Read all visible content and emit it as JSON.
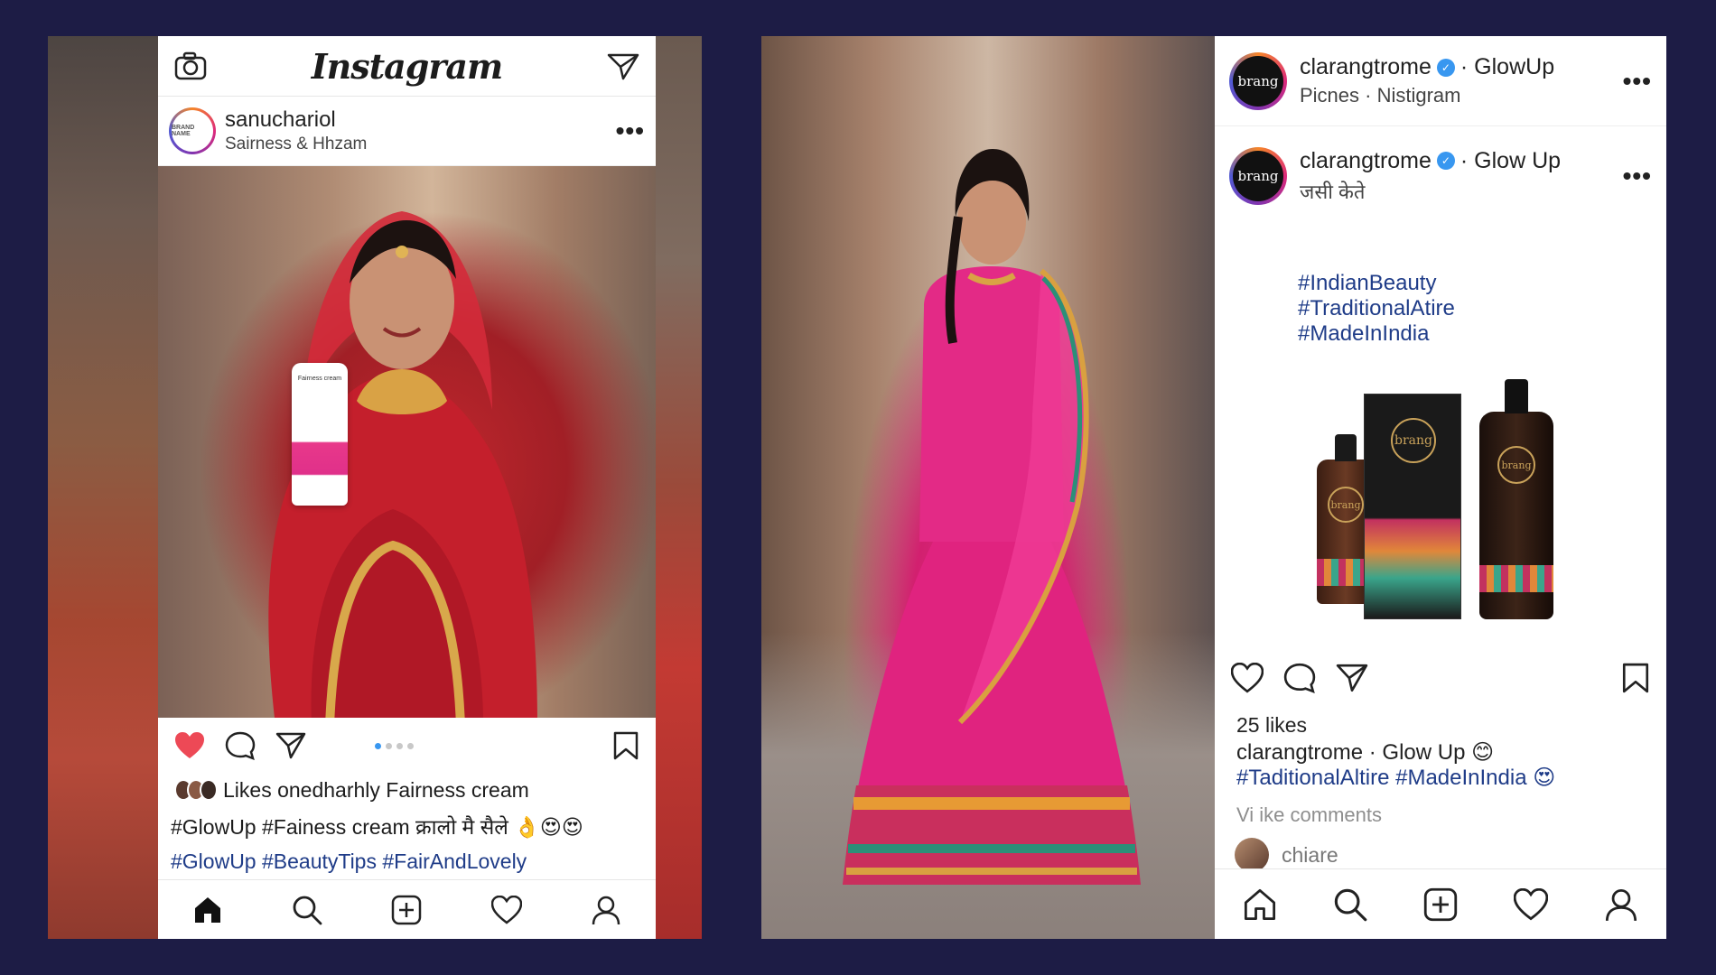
{
  "left_post": {
    "app_title": "Instagram",
    "username": "sanuchariol",
    "subtitle": "Sairness & Hhzam",
    "avatar_text": "BRAND NAME",
    "product_text": "Fairness cream",
    "liked": true,
    "likes_text": "Likes onedharhly Fairness cream",
    "caption_line": "#GlowUp #Fainess cream क्रालो मै सैले 👌😍😍",
    "hashtags": "#GlowUp #BeautyTips #FairAndLovely",
    "carousel_dots": 4,
    "carousel_active": 0,
    "more_label": "•••"
  },
  "right_post": {
    "header1": {
      "username": "clarangtrome",
      "suffix": "· GlowUp",
      "subtitle": "Picnes · Nistigram",
      "avatar_text": "brang"
    },
    "header2": {
      "username": "clarangtrome",
      "suffix": "· Glow Up",
      "subtitle": "जसी केते",
      "avatar_text": "brang"
    },
    "hashtags_line1": "#IndianBeauty #TraditionalAtire",
    "hashtags_line2": "#MadeInIndia",
    "product_brand": "brang",
    "likes": "25 likes",
    "caption_user": "clarangtrome",
    "caption_rest": "· Glow Up 😊",
    "caption_tags": "#TaditionalAltire #MadeInIndia 😍",
    "view_comments": "Vi ike comments",
    "commenter": "chiare",
    "more_label": "•••"
  },
  "colors": {
    "background": "#1d1c45",
    "like_red": "#ed4956",
    "hashtag_blue": "#1f3c88",
    "verified_blue": "#3897f0"
  }
}
